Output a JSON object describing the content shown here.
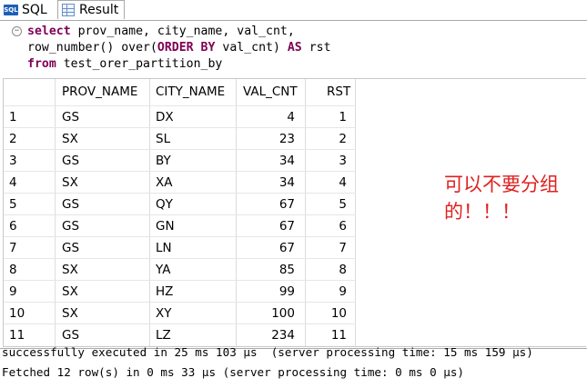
{
  "tabs": [
    {
      "label": "SQL",
      "icon": "sql-icon"
    },
    {
      "label": "Result",
      "icon": "result-grid-icon"
    }
  ],
  "editor": {
    "line1": {
      "kw": "select",
      "rest": " prov_name, city_name, val_cnt,"
    },
    "line2": {
      "pre": "row_number() over(",
      "kw1": "ORDER BY",
      "mid": " val_cnt) ",
      "kw2": "AS",
      "post": " rst"
    },
    "line3": {
      "kw": "from",
      "rest": " test_orer_partition_by"
    }
  },
  "table": {
    "columns": [
      "PROV_NAME",
      "CITY_NAME",
      "VAL_CNT",
      "RST"
    ],
    "rows": [
      {
        "n": "1",
        "prov": "GS",
        "city": "DX",
        "val": "4",
        "rst": "1"
      },
      {
        "n": "2",
        "prov": "SX",
        "city": "SL",
        "val": "23",
        "rst": "2"
      },
      {
        "n": "3",
        "prov": "GS",
        "city": "BY",
        "val": "34",
        "rst": "3"
      },
      {
        "n": "4",
        "prov": "SX",
        "city": "XA",
        "val": "34",
        "rst": "4"
      },
      {
        "n": "5",
        "prov": "GS",
        "city": "QY",
        "val": "67",
        "rst": "5"
      },
      {
        "n": "6",
        "prov": "GS",
        "city": "GN",
        "val": "67",
        "rst": "6"
      },
      {
        "n": "7",
        "prov": "GS",
        "city": "LN",
        "val": "67",
        "rst": "7"
      },
      {
        "n": "8",
        "prov": "SX",
        "city": "YA",
        "val": "85",
        "rst": "8"
      },
      {
        "n": "9",
        "prov": "SX",
        "city": "HZ",
        "val": "99",
        "rst": "9"
      },
      {
        "n": "10",
        "prov": "SX",
        "city": "XY",
        "val": "100",
        "rst": "10"
      },
      {
        "n": "11",
        "prov": "GS",
        "city": "LZ",
        "val": "234",
        "rst": "11"
      }
    ]
  },
  "annotation": {
    "line1": "可以不要分组",
    "line2": "的！！！",
    "color": "#e02020"
  },
  "status": {
    "line1": "successfully executed in 25 ms 103 µs  (server processing time: 15 ms 159 µs)",
    "line2": "Fetched 12 row(s) in 0 ms 33 µs (server processing time: 0 ms 0 µs)"
  }
}
